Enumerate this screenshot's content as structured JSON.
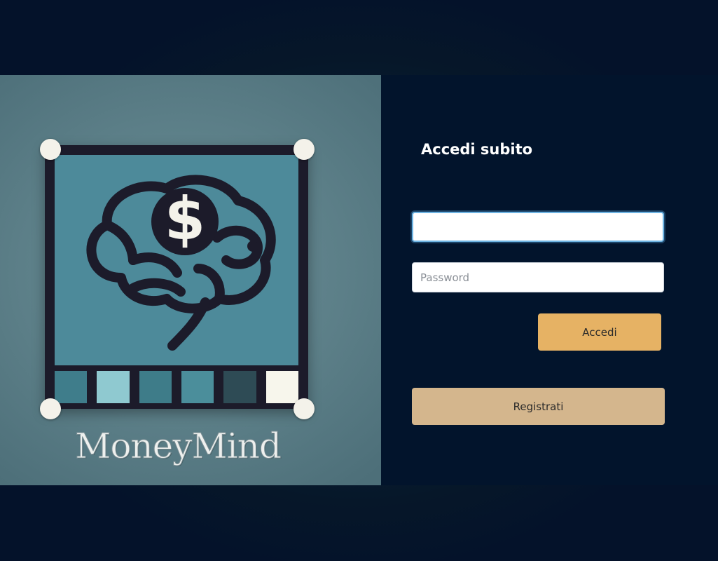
{
  "brand": {
    "name": "MoneyMind",
    "logo_icon": "brain-dollar-icon",
    "currency_symbol": "$",
    "colors": {
      "frame": "#1c1b2a",
      "inner": "#4d8a9a",
      "swatches": [
        "#3f7d8b",
        "#8fc9d0",
        "#3e7c89",
        "#4b8e9b",
        "#2e4b55",
        "#f7f6ec"
      ]
    }
  },
  "login": {
    "title": "Accedi subito",
    "username": {
      "value": "",
      "placeholder": ""
    },
    "password": {
      "value": "",
      "placeholder": "Password"
    },
    "login_label": "Accedi",
    "register_label": "Registrati"
  },
  "colors": {
    "form_background": "#02142c",
    "login_button": "#e6b264",
    "register_button": "#d4b68d",
    "focus_ring": "#6db3e2"
  }
}
